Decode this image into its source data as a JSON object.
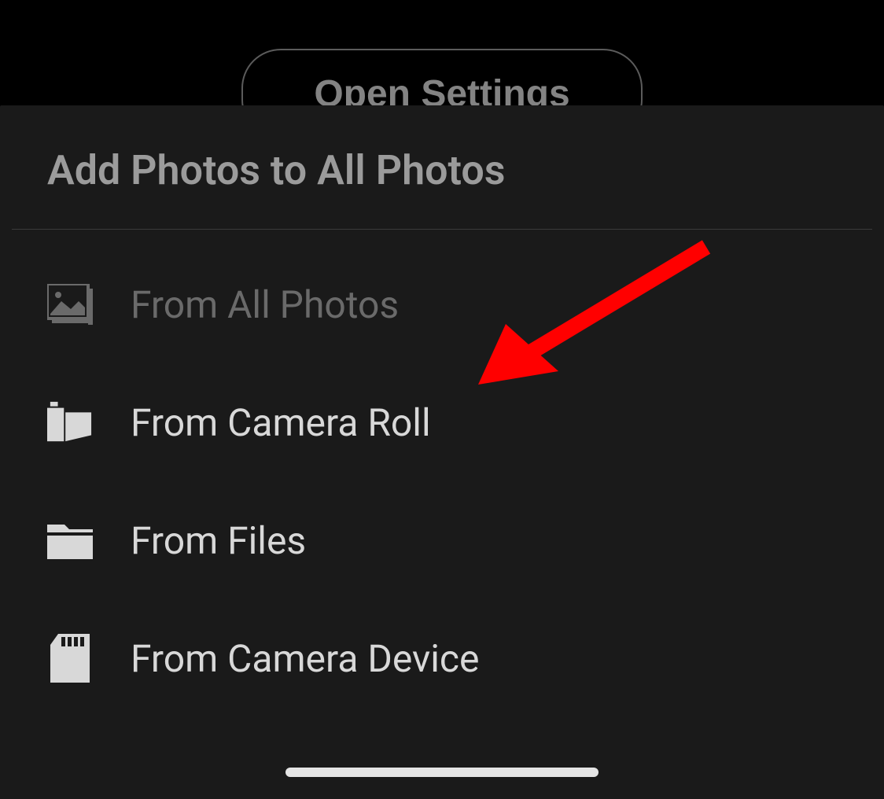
{
  "background": {
    "open_settings_label": "Open Settings"
  },
  "modal": {
    "title": "Add Photos to All Photos",
    "options": [
      {
        "label": "From All Photos",
        "icon": "photos-icon",
        "disabled": true
      },
      {
        "label": "From Camera Roll",
        "icon": "camera-roll-icon",
        "disabled": false
      },
      {
        "label": "From Files",
        "icon": "folder-icon",
        "disabled": false
      },
      {
        "label": "From Camera Device",
        "icon": "sd-card-icon",
        "disabled": false
      }
    ]
  },
  "annotation": {
    "arrow_color": "#ff0000"
  }
}
